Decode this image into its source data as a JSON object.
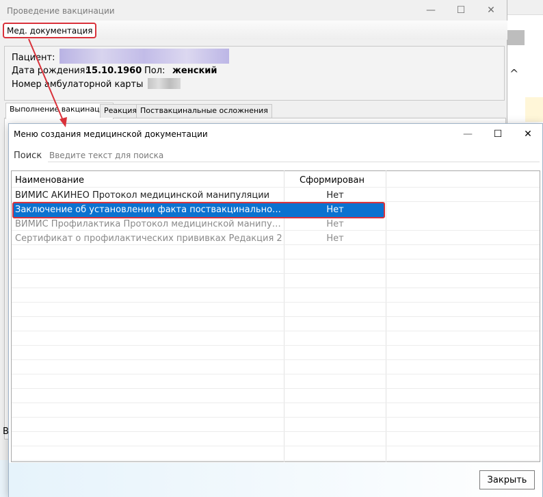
{
  "background_window": {
    "title": "Проведение вакцинации",
    "controls": {
      "minimize": "—",
      "maximize": "☐",
      "close": "✕"
    },
    "menu": {
      "med_docs": "Мед. документация"
    },
    "patient": {
      "patient_label": "Пациент:",
      "dob_label": "Дата рождения:",
      "dob_value": "15.10.1960",
      "sex_label": "Пол:",
      "sex_value": "женский",
      "card_label": "Номер амбулаторной карты"
    },
    "tabs": [
      {
        "label": "Выполнение вакцинации"
      },
      {
        "label": "Реакция"
      },
      {
        "label": "Поствакцинальные осложнения"
      }
    ],
    "bottom_fragment": "В",
    "side_chevron": "^"
  },
  "dialog": {
    "title": "Меню создания медицинской документации",
    "controls": {
      "minimize": "—",
      "maximize": "☐",
      "close": "✕"
    },
    "search": {
      "label": "Поиск",
      "placeholder": "Введите текст для поиска",
      "value": ""
    },
    "table": {
      "columns": [
        "Наименование",
        "Сформирован"
      ],
      "rows": [
        {
          "name": "ВИМИС АКИНЕО Протокол медицинской манипуляции",
          "status": "Нет"
        },
        {
          "name": "Заключение об установлении факта поствакцинального...",
          "status": "Нет"
        },
        {
          "name": "ВИМИС Профилактика Протокол медицинской манипул...",
          "status": "Нет"
        },
        {
          "name": "Сертификат о профилактических прививках Редакция 2",
          "status": "Нет"
        }
      ],
      "selected_index": 1
    },
    "close_button": "Закрыть"
  },
  "colors": {
    "highlight": "#d9313a",
    "selection": "#0b72d0"
  }
}
